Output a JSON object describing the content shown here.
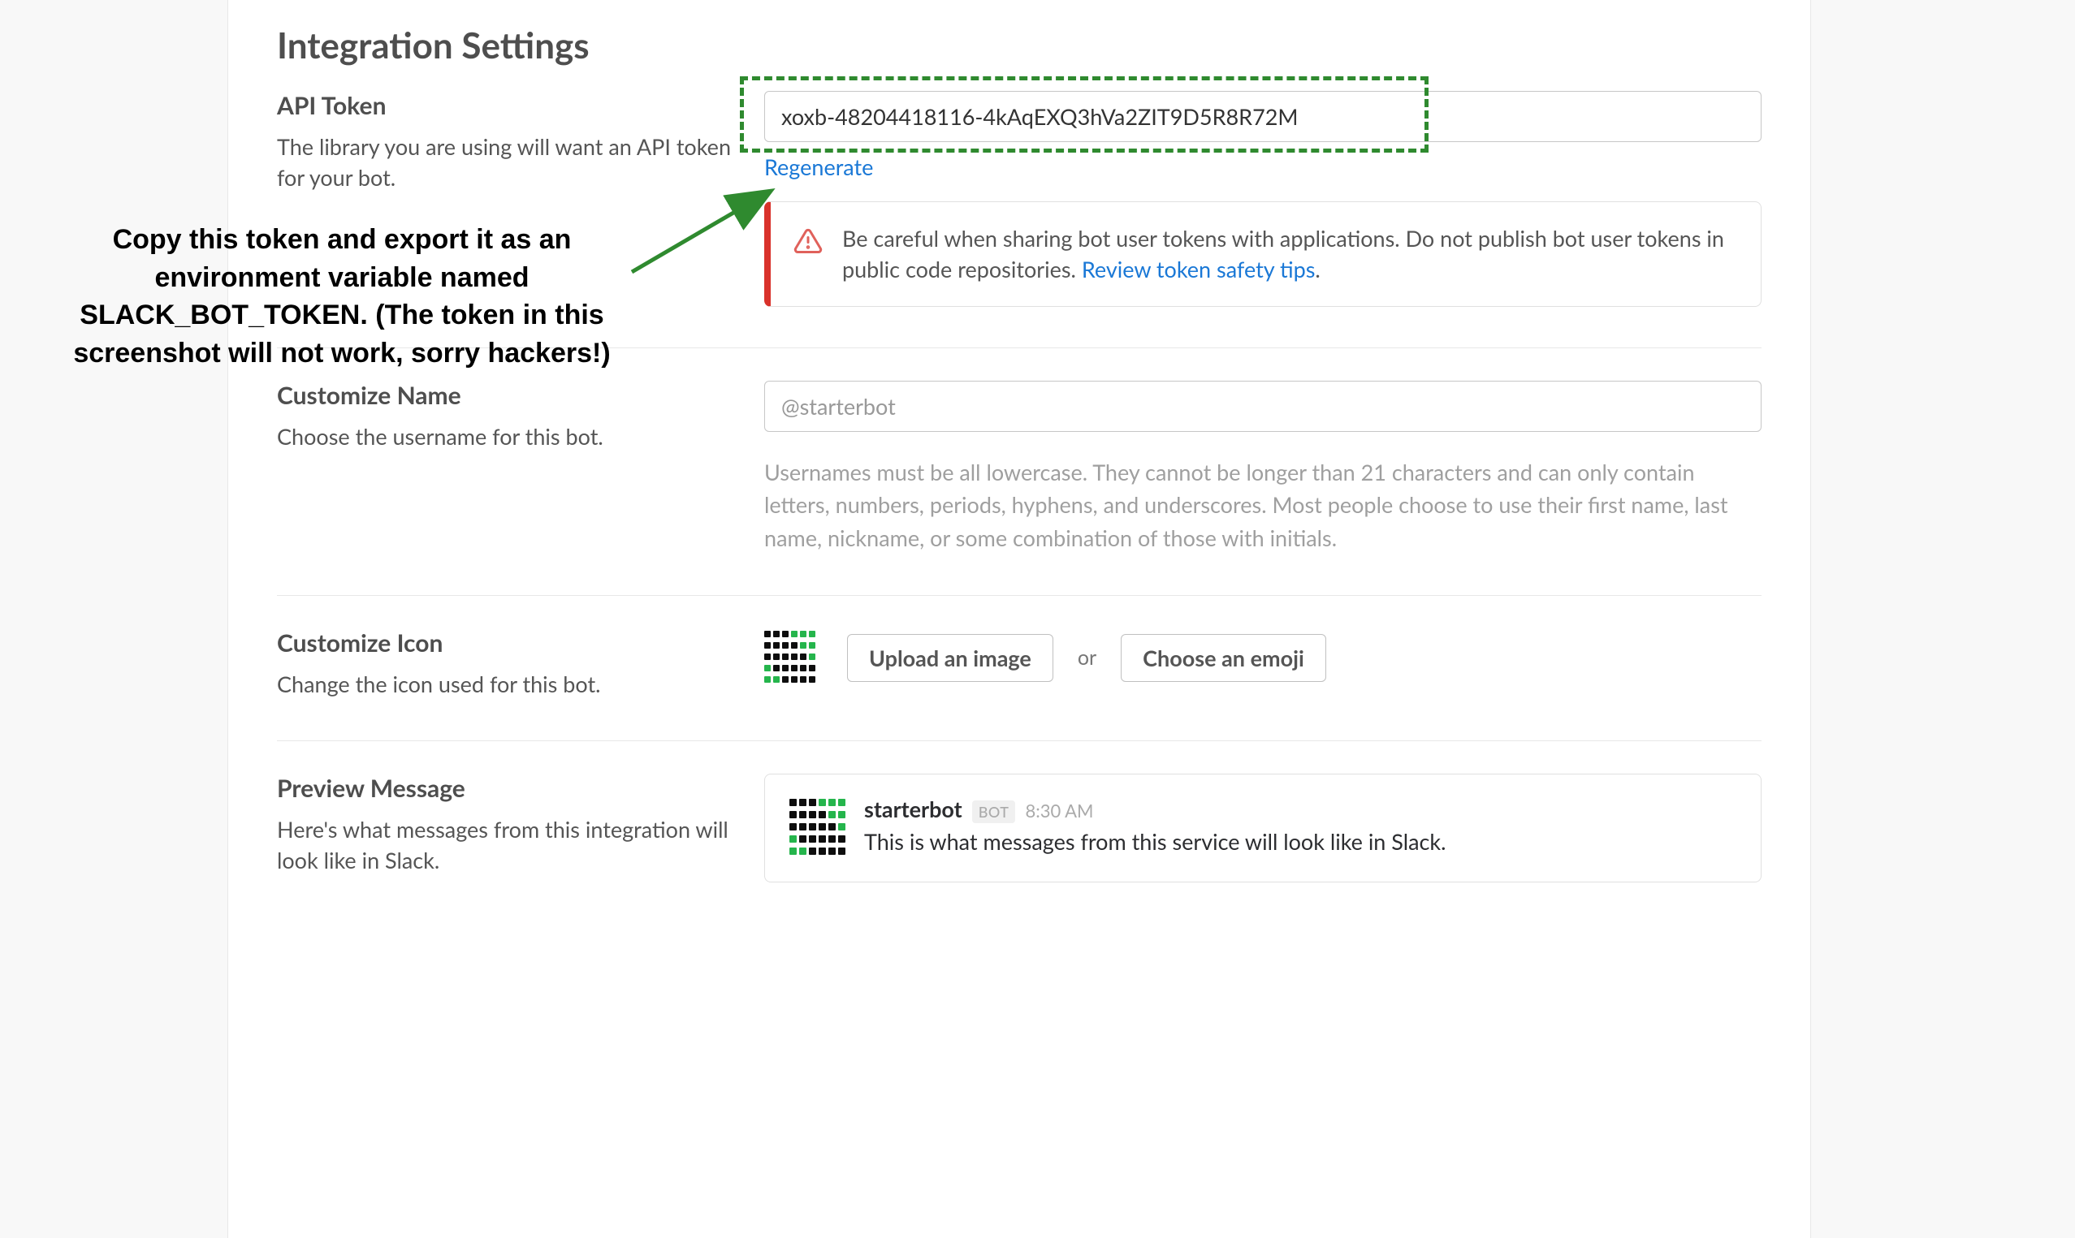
{
  "annotation": "Copy this token and export it as an environment variable named SLACK_BOT_TOKEN. (The token in this screenshot will not work, sorry hackers!)",
  "page_title": "Integration Settings",
  "api_token": {
    "heading": "API Token",
    "description": "The library you are using will want an API token for your bot.",
    "value": "xoxb-48204418116-4kAqEXQ3hVa2ZIT9D5R8R72M",
    "regenerate_label": "Regenerate",
    "warning_text_1": "Be careful when sharing bot user tokens with applications. Do not publish bot user tokens in public code repositories. ",
    "warning_link": "Review token safety tips",
    "warning_text_2": "."
  },
  "customize_name": {
    "heading": "Customize Name",
    "description": "Choose the username for this bot.",
    "placeholder": "@starterbot",
    "helper": "Usernames must be all lowercase. They cannot be longer than 21 characters and can only contain letters, numbers, periods, hyphens, and underscores. Most people choose to use their first name, last name, nickname, or some combination of those with initials."
  },
  "customize_icon": {
    "heading": "Customize Icon",
    "description": "Change the icon used for this bot.",
    "upload_label": "Upload an image",
    "or_label": "or",
    "emoji_label": "Choose an emoji"
  },
  "preview_message": {
    "heading": "Preview Message",
    "description": "Here's what messages from this integration will look like in Slack.",
    "name": "starterbot",
    "bot_tag": "BOT",
    "time": "8:30 AM",
    "message": "This is what messages from this service will look like in Slack."
  }
}
